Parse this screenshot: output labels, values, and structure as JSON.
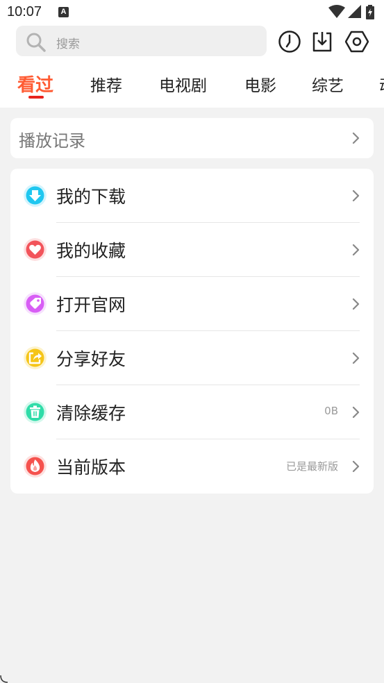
{
  "status_bar": {
    "time": "10:07",
    "notification_icon": "A",
    "icons": [
      "wifi-icon",
      "signal-icon",
      "battery-charging-icon"
    ]
  },
  "search": {
    "placeholder": "搜索",
    "icon": "search-icon"
  },
  "header_actions": [
    "history-clock-icon",
    "download-icon",
    "settings-hexagon-icon"
  ],
  "tabs": [
    {
      "label": "看过",
      "active": true
    },
    {
      "label": "推荐",
      "active": false
    },
    {
      "label": "电视剧",
      "active": false
    },
    {
      "label": "电影",
      "active": false
    },
    {
      "label": "综艺",
      "active": false
    },
    {
      "label": "动",
      "active": false
    }
  ],
  "history": {
    "label": "播放记录"
  },
  "menu": [
    {
      "label": "我的下载",
      "value": "",
      "icon": "download-circle-icon",
      "color": "#1fc7f0"
    },
    {
      "label": "我的收藏",
      "value": "",
      "icon": "heart-icon",
      "color": "#f2545b"
    },
    {
      "label": "打开官网",
      "value": "",
      "icon": "tag-icon",
      "color": "#d85ef5"
    },
    {
      "label": "分享好友",
      "value": "",
      "icon": "share-icon",
      "color": "#f5c518"
    },
    {
      "label": "清除缓存",
      "value": "0B",
      "icon": "trash-icon",
      "color": "#2fdca8"
    },
    {
      "label": "当前版本",
      "value": "已是最新版",
      "icon": "flame-icon",
      "color": "#f5524e"
    }
  ],
  "colors": {
    "accent": "#ff5b33",
    "tab_indicator": "#e8231e",
    "background": "#f2f2f2"
  }
}
